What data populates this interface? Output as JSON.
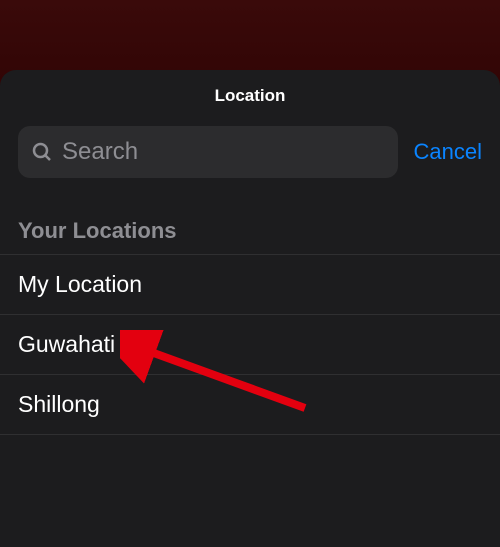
{
  "sheet": {
    "title": "Location",
    "search": {
      "placeholder": "Search"
    },
    "cancel_label": "Cancel"
  },
  "locations": {
    "section_title": "Your Locations",
    "items": [
      {
        "label": "My Location"
      },
      {
        "label": "Guwahati"
      },
      {
        "label": "Shillong"
      }
    ]
  },
  "annotation": {
    "target_index": 1
  },
  "colors": {
    "accent": "#0a84ff",
    "sheet_bg": "#1c1c1e",
    "field_bg": "#2c2c2e",
    "secondary_text": "#8e8e93",
    "arrow": "#e3000f"
  }
}
